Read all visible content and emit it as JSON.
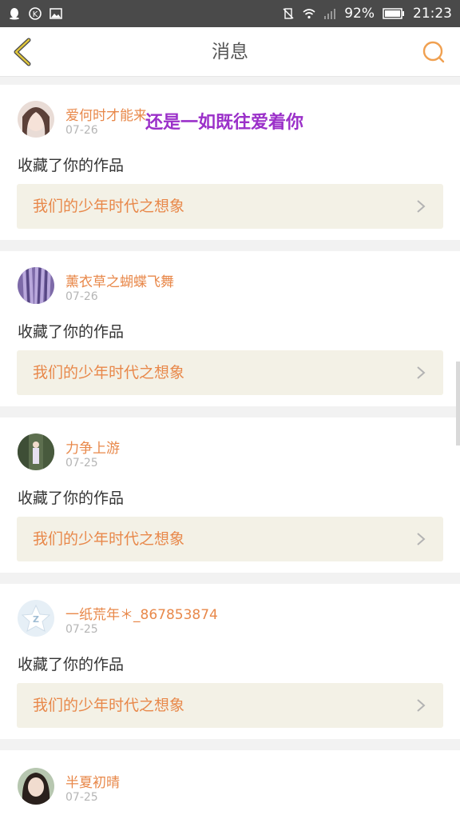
{
  "status_bar": {
    "battery": "92%",
    "time": "21:23",
    "left_icons": [
      "qq-icon",
      "k-icon",
      "image-icon"
    ]
  },
  "header": {
    "title": "消息"
  },
  "overlay_text": "还是一如既往爱着你",
  "action_text": "收藏了你的作品",
  "work_title": "我们的少年时代之想象",
  "notifications": [
    {
      "name": "爱何时才能来",
      "date": "07-26",
      "avatar": "girl-avatar"
    },
    {
      "name": "薰衣草之蝴蝶飞舞",
      "date": "07-26",
      "avatar": "lavender-avatar"
    },
    {
      "name": "力争上游",
      "date": "07-25",
      "avatar": "forest-avatar"
    },
    {
      "name": "一纸荒年＊_867853874",
      "date": "07-25",
      "avatar": "default-star-avatar"
    },
    {
      "name": "半夏初晴",
      "date": "07-25",
      "avatar": "portrait-avatar"
    }
  ],
  "colors": {
    "accent": "#e8884a",
    "work_bg": "#f3f1e6",
    "overlay": "#9b30c9"
  }
}
